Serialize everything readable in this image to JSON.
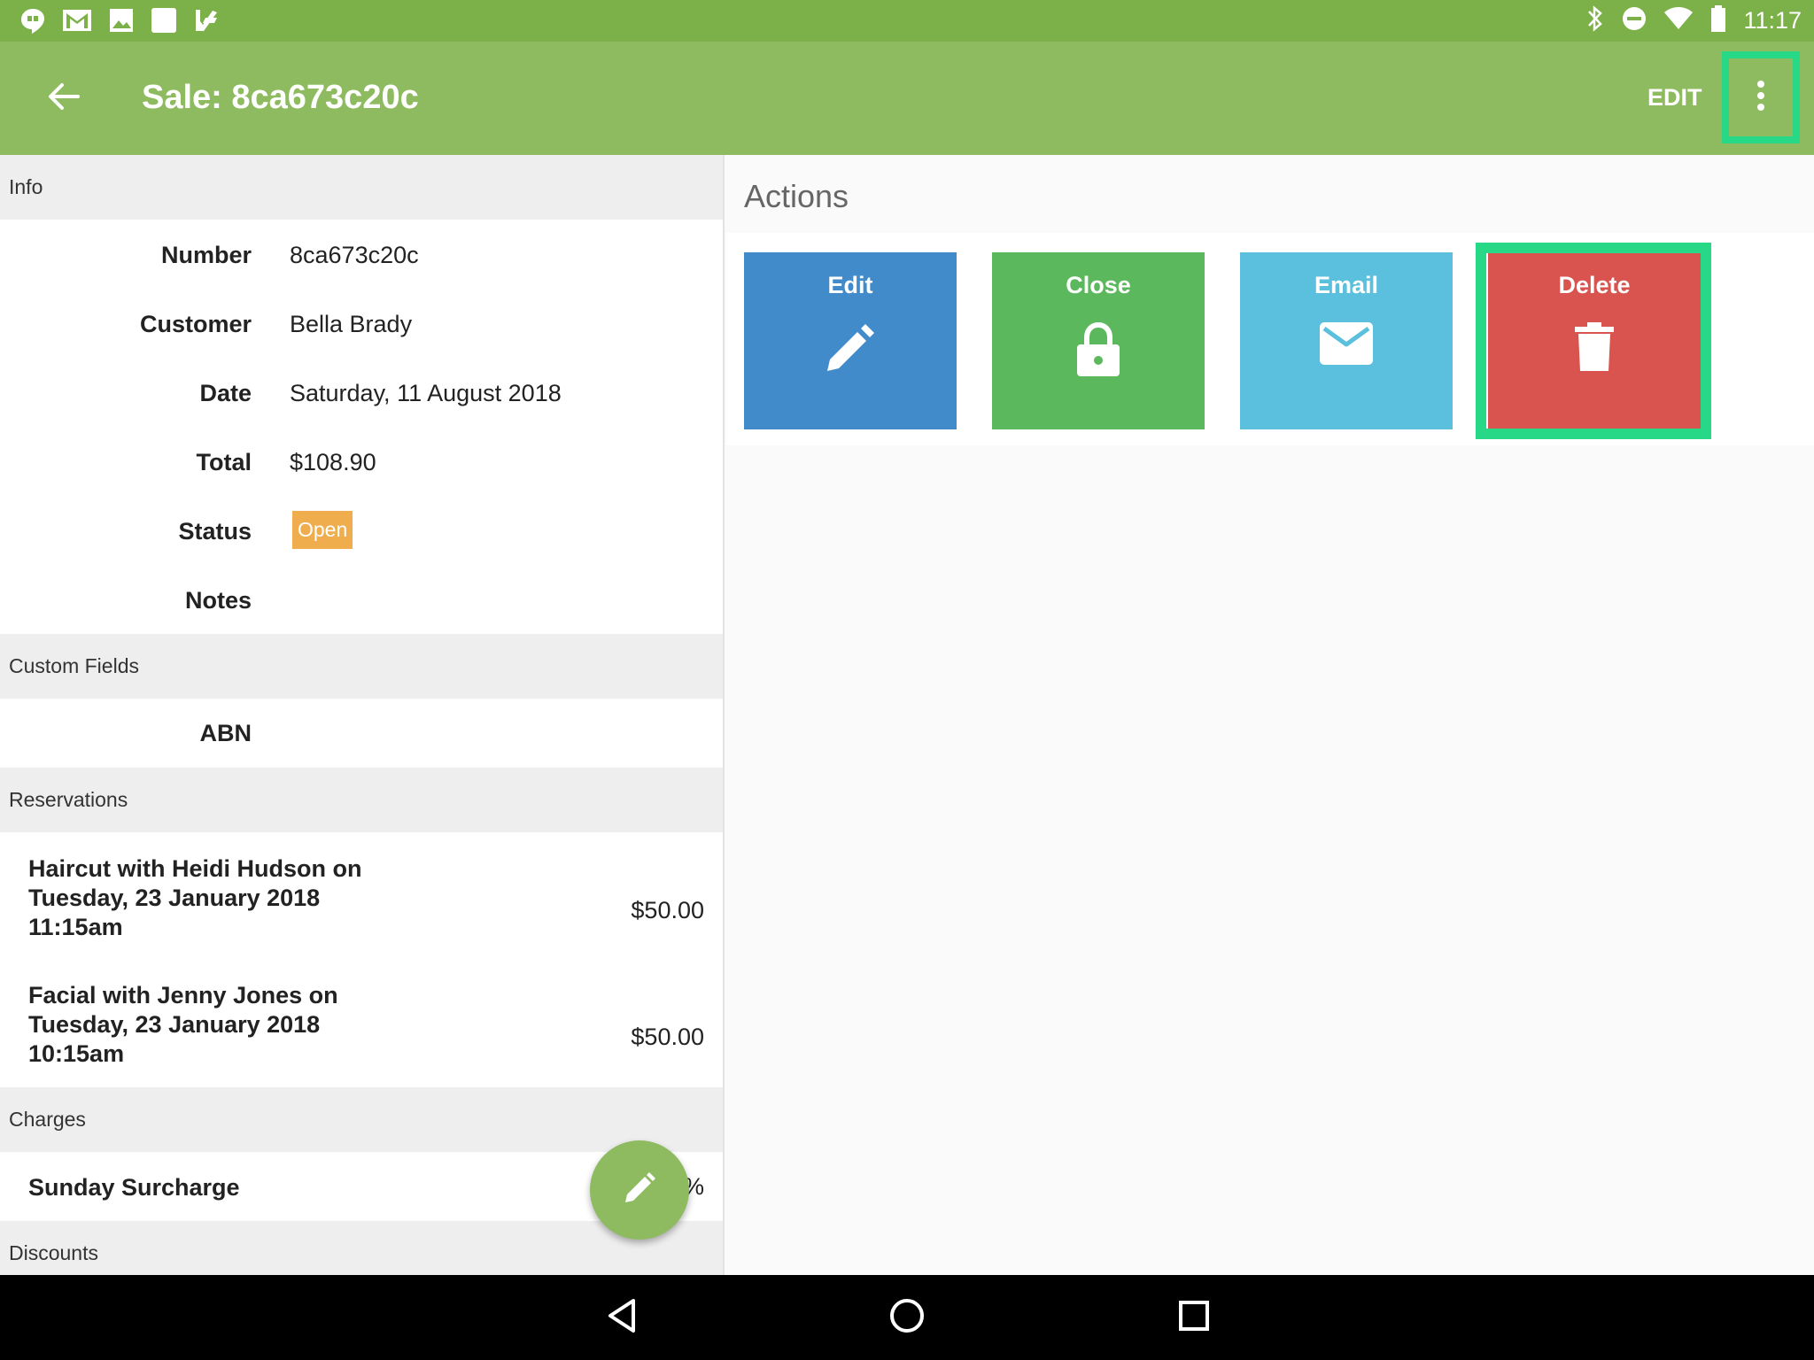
{
  "status_bar": {
    "time": "11:17",
    "left_icons": [
      "hangouts-icon",
      "gmail-icon",
      "photos-icon",
      "blank-notification-icon",
      "delivery-icon"
    ],
    "right_icons": [
      "bluetooth-icon",
      "do-not-disturb-icon",
      "wifi-icon",
      "battery-icon"
    ]
  },
  "app_bar": {
    "title": "Sale: 8ca673c20c",
    "edit_label": "EDIT",
    "back_icon": "arrow-left-icon",
    "overflow_icon": "more-vertical-icon"
  },
  "info": {
    "header": "Info",
    "fields": {
      "number_label": "Number",
      "number_value": "8ca673c20c",
      "customer_label": "Customer",
      "customer_value": "Bella Brady",
      "date_label": "Date",
      "date_value": "Saturday, 11 August 2018",
      "total_label": "Total",
      "total_value": "$108.90",
      "status_label": "Status",
      "status_value": "Open",
      "notes_label": "Notes"
    }
  },
  "custom_fields": {
    "header": "Custom Fields",
    "abn_label": "ABN"
  },
  "reservations": {
    "header": "Reservations",
    "items": [
      {
        "line1": "Haircut with Heidi Hudson on",
        "line2": "Tuesday, 23 January 2018",
        "line3": "11:15am",
        "price": "$50.00"
      },
      {
        "line1": "Facial with Jenny Jones on",
        "line2": "Tuesday, 23 January 2018",
        "line3": "10:15am",
        "price": "$50.00"
      }
    ]
  },
  "charges": {
    "header": "Charges",
    "items": [
      {
        "name": "Sunday Surcharge",
        "value_suffix": "%"
      }
    ]
  },
  "discounts": {
    "header": "Discounts"
  },
  "actions": {
    "title": "Actions",
    "tiles": [
      {
        "label": "Edit",
        "icon": "pencil-icon",
        "color": "#428bca"
      },
      {
        "label": "Close",
        "icon": "lock-icon",
        "color": "#5cb85c"
      },
      {
        "label": "Email",
        "icon": "envelope-icon",
        "color": "#5bc0de"
      },
      {
        "label": "Delete",
        "icon": "trash-icon",
        "color": "#d9534f"
      }
    ]
  },
  "colors": {
    "status_bar": "#7cb048",
    "app_bar": "#8ebb5f",
    "status_badge": "#f0ad4e",
    "highlight": "#27d986"
  },
  "nav_bar": {
    "icons": [
      "nav-back-icon",
      "nav-home-icon",
      "nav-recents-icon"
    ]
  }
}
